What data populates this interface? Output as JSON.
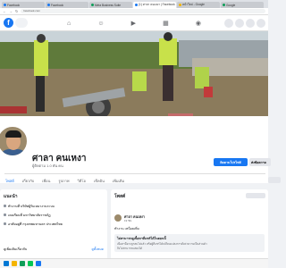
{
  "browser": {
    "tabs": [
      {
        "label": "Facebook",
        "active": false
      },
      {
        "label": "Facebook",
        "active": false
      },
      {
        "label": "Meta Business Suite",
        "active": false
      },
      {
        "label": "(1) ศาลา คนเหงา | Facebook",
        "active": true
      },
      {
        "label": "หน้าใหม่ - Google",
        "active": false
      },
      {
        "label": "Google",
        "active": false
      }
    ],
    "url": "facebook.com"
  },
  "profile": {
    "name": "ศาลา คนเหงา",
    "followers": "ผู้ติดตาม 1.0 พัน คน",
    "follow_button": "ติดตามโปรไฟล์",
    "message_button": "ส่งข้อความ"
  },
  "tabs": [
    "โพสต์",
    "เกี่ยวกับ",
    "เพื่อน",
    "รูปภาพ",
    "วิดีโอ",
    "เช็คอิน",
    "เพิ่มเติม"
  ],
  "intro": {
    "title": "แนะนำ",
    "rows": [
      "ทำงานที่ บริษัทผู้รับเหมางานระบบ",
      "เคยเรียนที่ มหาวิทยาลัยราชภัฏ",
      "อาศัยอยู่ที่ กรุงเทพมหานคร ประเทศไทย"
    ],
    "bottom_left": "ดูเพิ่มเติมเกี่ยวกับ",
    "bottom_link": "ดูทั้งหมด"
  },
  "feed": {
    "title": "โพสต์",
    "post": {
      "author": "ศาลา คนเหงา",
      "time": "19 ชม.",
      "body": "ทำงาน เหนื่อยเพิ่ม",
      "box_title": "ไม่สามารถดูเนื้อหาที่แชร์ได้ในตอนนี้",
      "box_desc1": "เนื้อหานี้อาจถูกลบไปแล้ว หรือผู้ที่แชร์ได้เปลี่ยนแปลงการตั้งค่าความเป็นส่วนตัว",
      "box_desc2": "จึงไม่สามารถแสดงได้"
    }
  }
}
